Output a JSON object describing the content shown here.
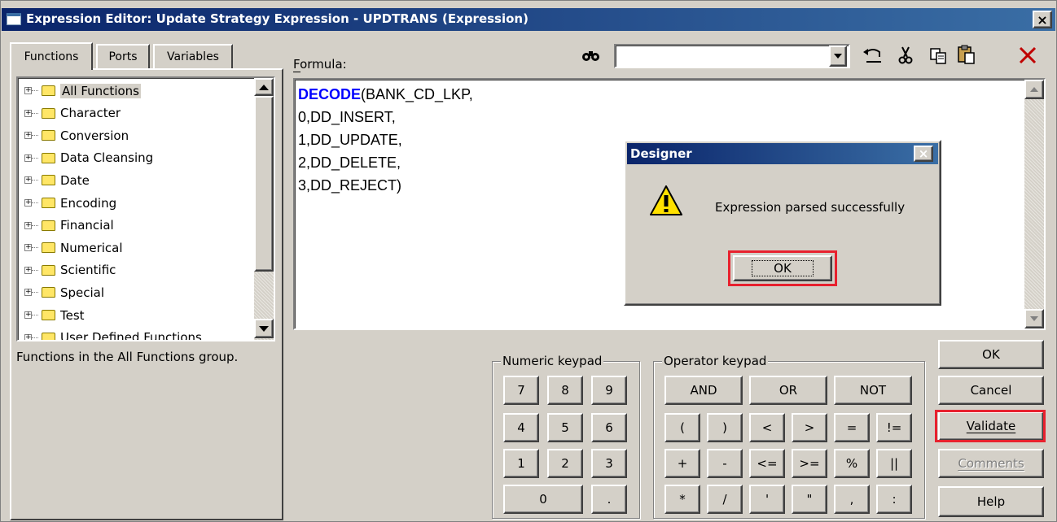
{
  "window": {
    "title": "Expression Editor: Update Strategy Expression - UPDTRANS (Expression)",
    "close_glyph": "×"
  },
  "tabs": [
    {
      "label": "Functions"
    },
    {
      "label": "Ports"
    },
    {
      "label": "Variables"
    }
  ],
  "tree": {
    "items": [
      {
        "label": "All Functions"
      },
      {
        "label": "Character"
      },
      {
        "label": "Conversion"
      },
      {
        "label": "Data Cleansing"
      },
      {
        "label": "Date"
      },
      {
        "label": "Encoding"
      },
      {
        "label": "Financial"
      },
      {
        "label": "Numerical"
      },
      {
        "label": "Scientific"
      },
      {
        "label": "Special"
      },
      {
        "label": "Test"
      },
      {
        "label": "User Defined Functions"
      }
    ]
  },
  "description": "Functions in the All Functions group.",
  "formula": {
    "label": "Formula:",
    "keyword": "DECODE",
    "line1_rest": "(BANK_CD_LKP,",
    "lines": [
      "0,DD_INSERT,",
      "1,DD_UPDATE,",
      "2,DD_DELETE,",
      "3,DD_REJECT)"
    ]
  },
  "search": {
    "value": ""
  },
  "numeric_keypad": {
    "label": "Numeric keypad",
    "keys": [
      "7",
      "8",
      "9",
      "4",
      "5",
      "6",
      "1",
      "2",
      "3",
      "0",
      "."
    ]
  },
  "operator_keypad": {
    "label": "Operator keypad",
    "row1": [
      "AND",
      "OR",
      "NOT"
    ],
    "keys": [
      "(",
      ")",
      "<",
      ">",
      "=",
      "!=",
      "+",
      "-",
      "<=",
      ">=",
      "%",
      "||",
      "*",
      "/",
      "'",
      "\"",
      ",",
      ":"
    ]
  },
  "buttons": {
    "ok": "OK",
    "cancel": "Cancel",
    "validate": "Validate",
    "comments": "Comments",
    "help": "Help"
  },
  "dialog": {
    "title": "Designer",
    "message": "Expression parsed successfully",
    "ok_label": "OK"
  },
  "colors": {
    "keyword": "#0000ff",
    "highlight_box": "#e8212e",
    "title_bar": "#0a246a"
  }
}
